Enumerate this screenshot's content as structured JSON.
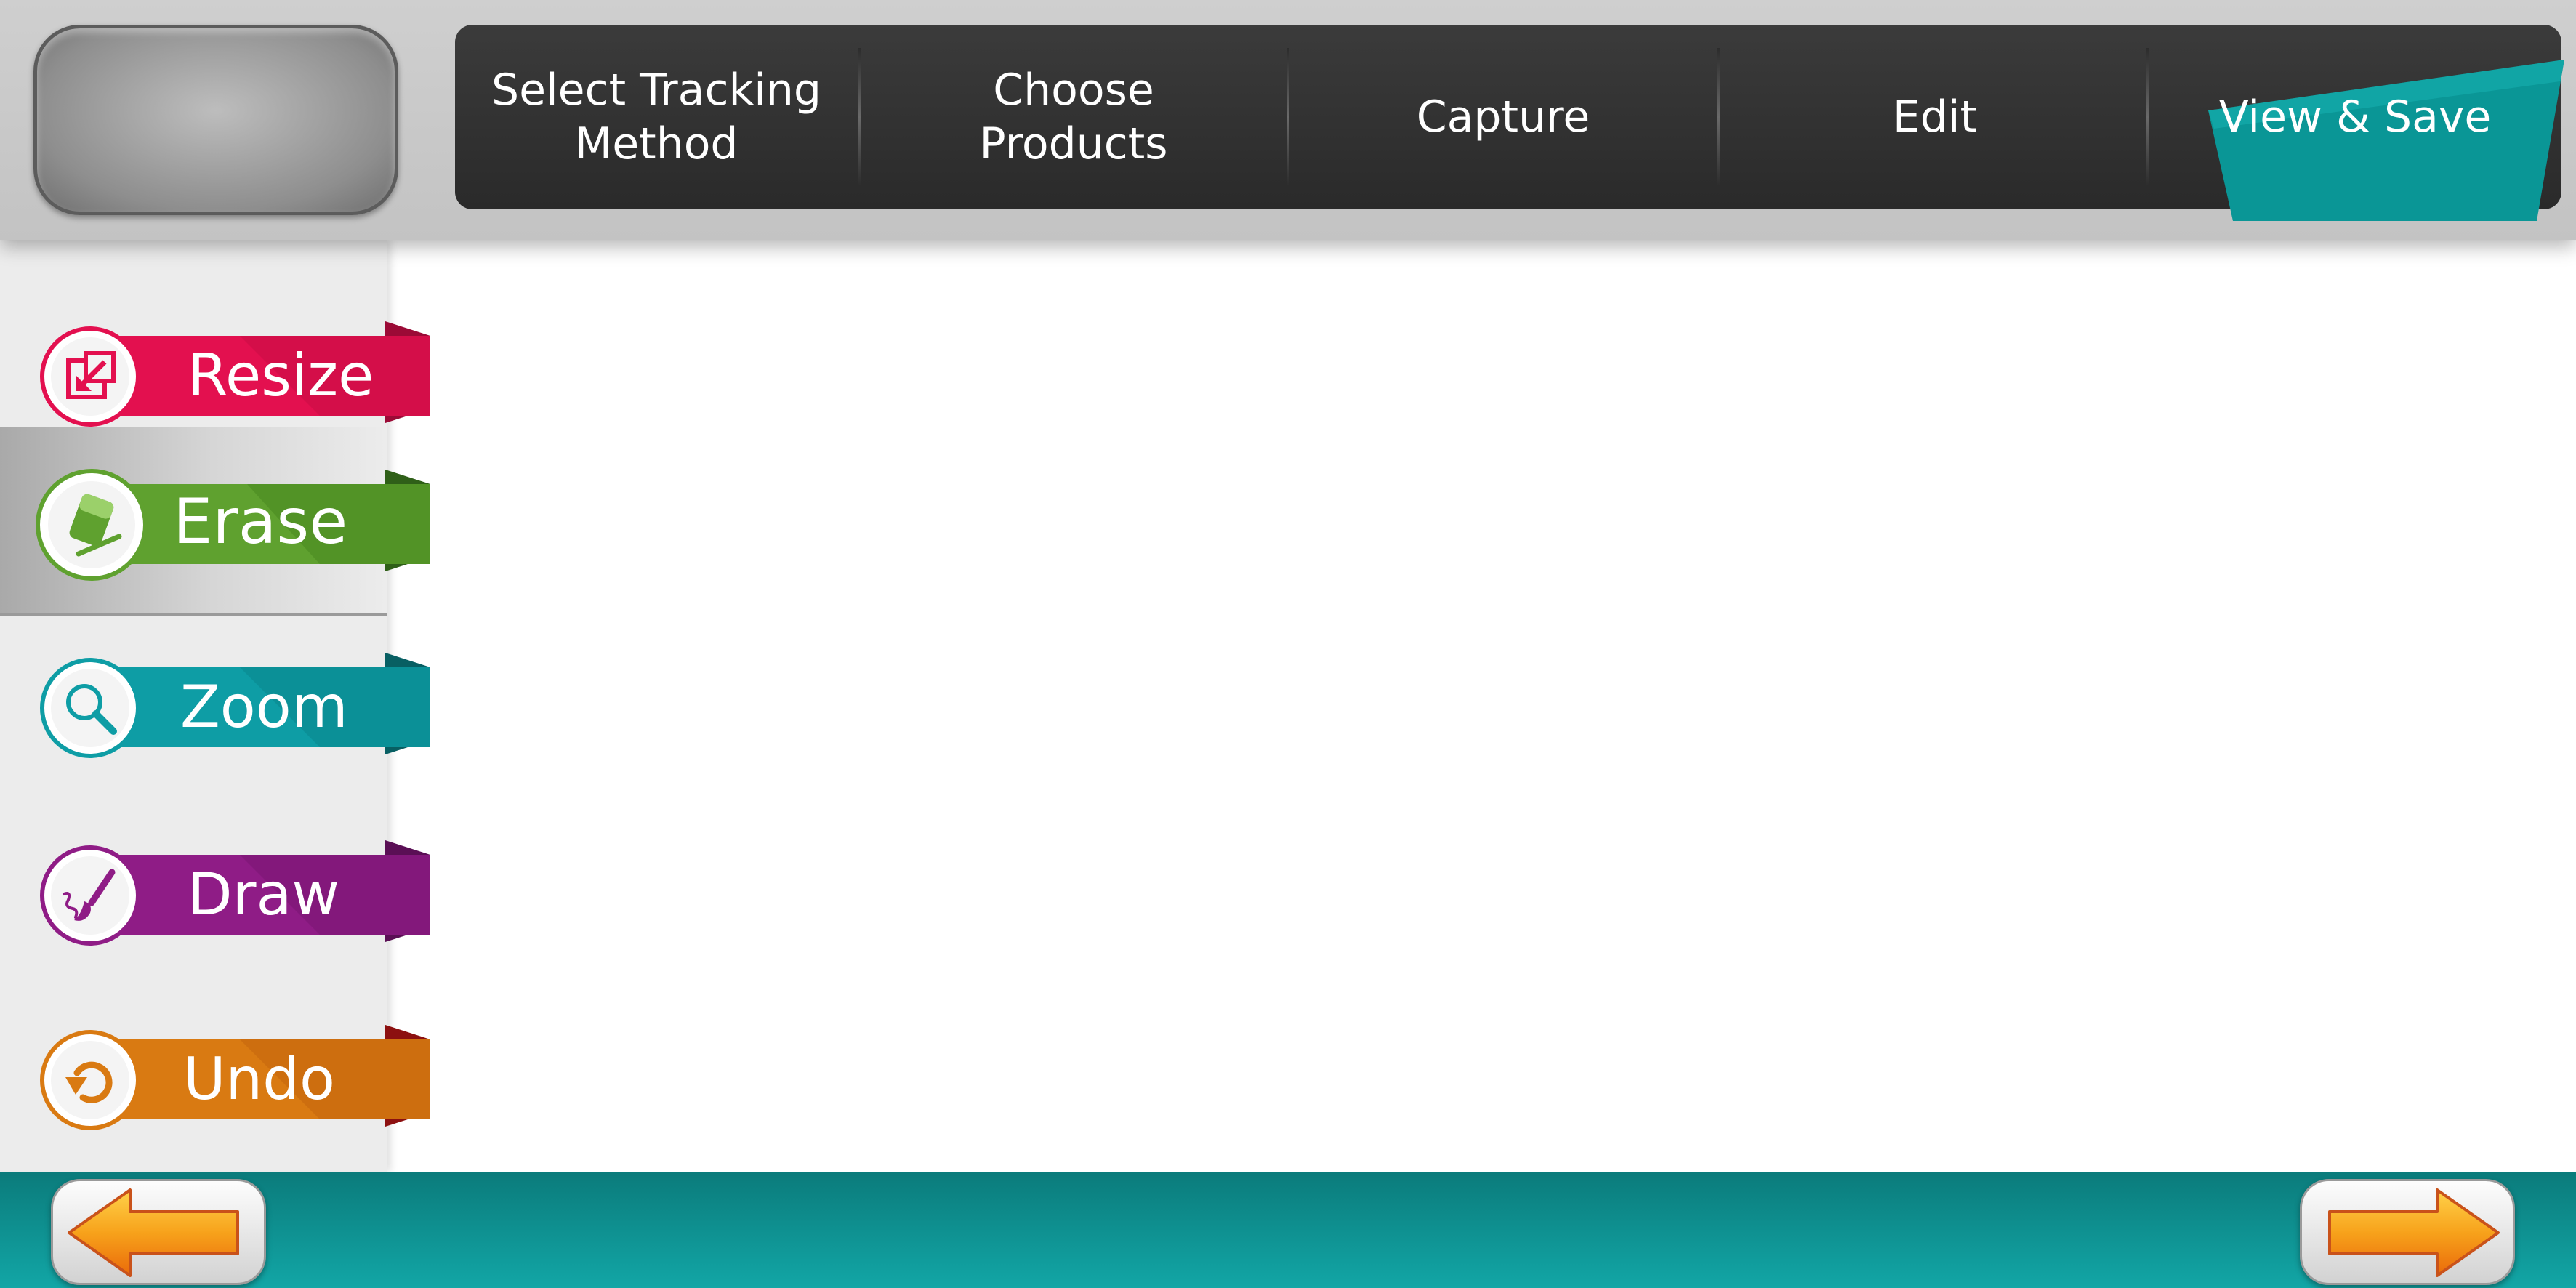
{
  "header": {
    "tabs": [
      {
        "label": "Select Tracking\nMethod",
        "active": false
      },
      {
        "label": "Choose\nProducts",
        "active": false
      },
      {
        "label": "Capture",
        "active": false
      },
      {
        "label": "Edit",
        "active": true
      },
      {
        "label": "View & Save",
        "active": false
      }
    ]
  },
  "sidebar": {
    "tools": [
      {
        "label": "Resize",
        "icon": "resize-icon",
        "color": "#e3104f",
        "active": false
      },
      {
        "label": "Erase",
        "icon": "eraser-icon",
        "color": "#5fa12f",
        "active": true
      },
      {
        "label": "Zoom",
        "icon": "magnifier-icon",
        "color": "#0e9da5",
        "active": false
      },
      {
        "label": "Draw",
        "icon": "paintbrush-icon",
        "color": "#8f1c86",
        "active": false
      },
      {
        "label": "Undo",
        "icon": "undo-icon",
        "color": "#d97a12",
        "active": false
      }
    ]
  },
  "footer": {
    "back_icon": "arrow-left-icon",
    "next_icon": "arrow-right-icon",
    "accent": "#0e9e9e"
  },
  "colors": {
    "tab_bar": "#2f2f2f",
    "tab_active": "#0b9c9c",
    "sidebar_bg": "#ececec",
    "footer": "#0e9e9e",
    "arrow": "#f39214"
  }
}
